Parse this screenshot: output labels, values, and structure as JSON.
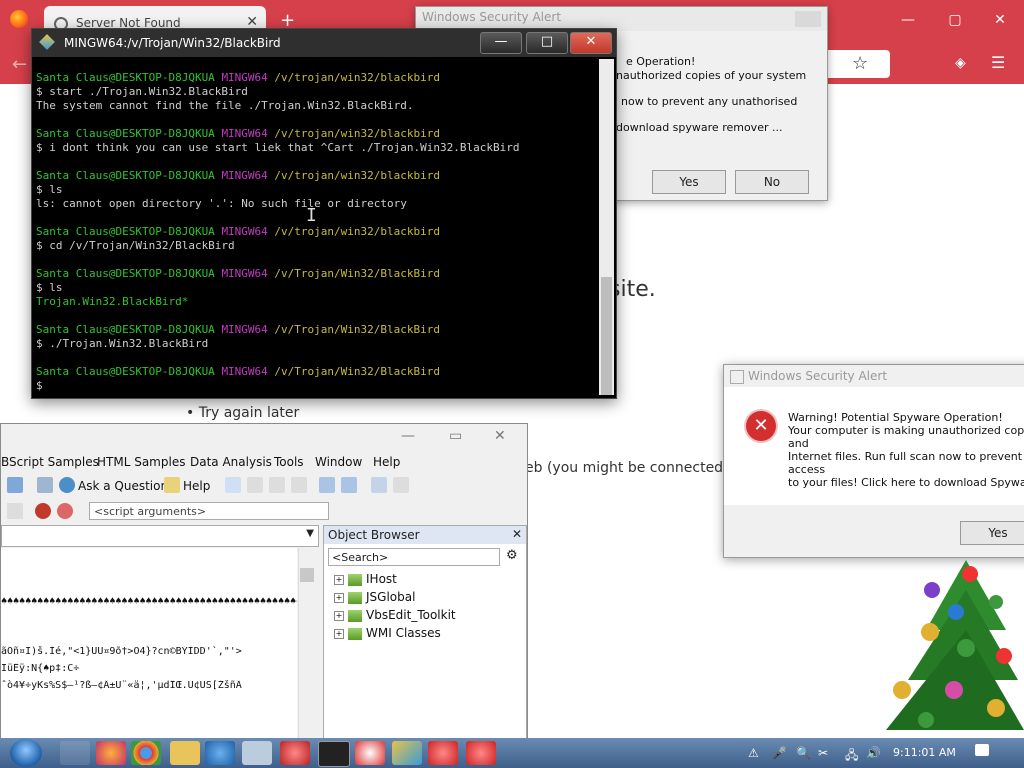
{
  "browser": {
    "tab_title": "Server Not Found",
    "tab_close": "✕",
    "new_tab": "+",
    "minimize": "—",
    "maximize": "▢",
    "close": "✕",
    "back": "←",
    "star": "☆",
    "menu": "☰",
    "page_suffix": "site.",
    "bullet_text": "Try again later",
    "web_text": "eb (you might be connected b"
  },
  "alert1": {
    "title": "Windows Security Alert",
    "lines": [
      "e Operation!",
      "nauthorized copies of your system",
      "now to prevent any unathorised",
      "download spyware remover ..."
    ],
    "yes": "Yes",
    "no": "No"
  },
  "terminal": {
    "title": "MINGW64:/v/Trojan/Win32/BlackBird",
    "min": "—",
    "max": "□",
    "close": "✕",
    "user": "Santa Claus@DESKTOP-D8JQKUA",
    "shell": "MINGW64",
    "path_lower": "/v/trojan/win32/blackbird",
    "path_upper": "/v/Trojan/Win32/BlackBird",
    "cmd1": "$ start ./Trojan.Win32.BlackBird",
    "out1": "The system cannot find the file ./Trojan.Win32.BlackBird.",
    "cmd2": "$ i dont think you can use start liek that ^Cart ./Trojan.Win32.BlackBird",
    "cmd3": "$ ls",
    "out3": "ls: cannot open directory '.': No such file or directory",
    "cmd4": "$ cd /v/Trojan/Win32/BlackBird",
    "cmd5": "$ ls",
    "out5": "Trojan.Win32.BlackBird*",
    "cmd6": "$ ./Trojan.Win32.BlackBird",
    "prompt": "$"
  },
  "vbsedit": {
    "min": "—",
    "max": "▭",
    "close": "✕",
    "menu": [
      "BScript Samples",
      "HTML Samples",
      "Data Analysis",
      "Tools",
      "Window",
      "Help"
    ],
    "ask": "Ask a Question",
    "help": "Help",
    "args_placeholder": "<script arguments>",
    "editor_lines": [
      "♠♠♠♠♠♠♠♠♠♠♠♠♠♠♠♠♠♠♠♠♠♠♠♠♠♠♠♠♠♠♠♠♠♠♠♠♠♠♠♠♠♠♠♠♠♠♠♠♠♠♠",
      "ãÕñ¤I)š.Ìé,\"<1}UÙ¤9õ†>Ö4}?cn©BÝÌDD'`,\"'>",
      "ÏüÊÿ:N{♠p‡:C÷",
      "ˆò4¥÷yKs%S$—¹?ß—¢Â±Ü¨«ä¦,'µdÎŒ.U¢ÙŠ[ŽšñÂ"
    ]
  },
  "object_browser": {
    "title": "Object Browser",
    "pin": "📌",
    "close": "✕",
    "search": "<Search>",
    "items": [
      "IHost",
      "JSGlobal",
      "VbsEdit_Toolkit",
      "WMI Classes"
    ]
  },
  "alert2": {
    "title": "Windows Security Alert",
    "lines": [
      "Warning! Potential Spyware Operation!",
      "Your computer is making unauthorized copies",
      "and",
      "Internet files. Run full scan now to prevent any",
      "access",
      "to your files! Click here to download Spyware"
    ],
    "yes": "Yes"
  },
  "taskbar": {
    "clock": "9:11:01 AM"
  },
  "colors": {
    "browser_red": "#d6404a",
    "terminal_green": "#2fc42f",
    "terminal_magenta": "#c23ac2",
    "terminal_yellow": "#c9bb39"
  }
}
